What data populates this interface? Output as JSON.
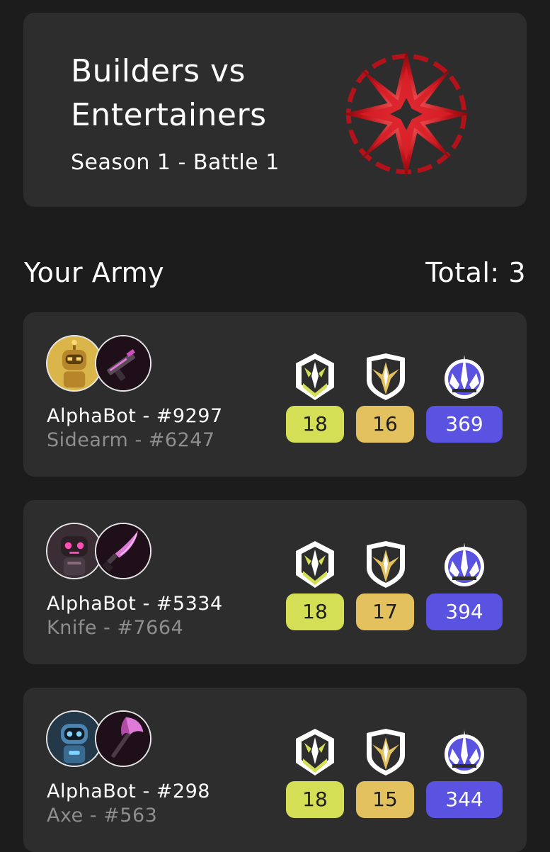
{
  "battle": {
    "title_line1": "Builders vs",
    "title_line2": "Entertainers",
    "subtitle": "Season 1 - Battle 1",
    "emblem_icon": "red-crystal-star-emblem"
  },
  "army": {
    "title": "Your Army",
    "total": "Total: 3"
  },
  "colors": {
    "attack_pill": "#d4df56",
    "defense_pill": "#e2c15e",
    "power_pill": "#5a52e0",
    "card_bg": "#2d2d2d",
    "page_bg": "#1c1c1c"
  },
  "units": [
    {
      "name": "AlphaBot - #9297",
      "weapon": "Sidearm - #6247",
      "bot_icon": "gold-robot-avatar",
      "weapon_icon": "sidearm-icon",
      "attack": "18",
      "defense": "16",
      "power": "369"
    },
    {
      "name": "AlphaBot - #5334",
      "weapon": "Knife - #7664",
      "bot_icon": "dark-pink-robot-avatar",
      "weapon_icon": "knife-icon",
      "attack": "18",
      "defense": "17",
      "power": "394"
    },
    {
      "name": "AlphaBot - #298",
      "weapon": "Axe - #563",
      "bot_icon": "blue-robot-avatar",
      "weapon_icon": "axe-icon",
      "attack": "18",
      "defense": "15",
      "power": "344"
    }
  ]
}
